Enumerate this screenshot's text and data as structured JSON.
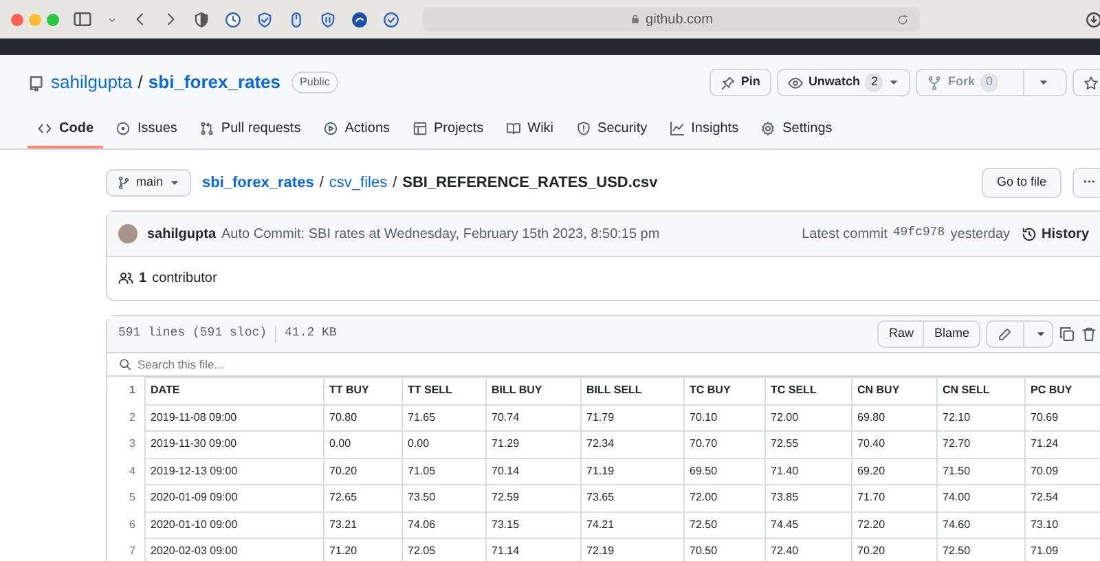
{
  "browser": {
    "address": "github.com"
  },
  "repo": {
    "owner": "sahilgupta",
    "separator": "/",
    "name": "sbi_forex_rates",
    "visibility": "Public",
    "actions": [
      {
        "label": "Pin",
        "kind": "pin",
        "disabled": false
      },
      {
        "label": "Unwatch",
        "kind": "watch",
        "count": "2",
        "disabled": false
      },
      {
        "label": "Fork",
        "kind": "fork",
        "count": "0",
        "disabled": true
      }
    ]
  },
  "tabs": [
    {
      "label": "Code",
      "kind": "code",
      "selected": true
    },
    {
      "label": "Issues",
      "kind": "issues",
      "selected": false
    },
    {
      "label": "Pull requests",
      "kind": "pulls",
      "selected": false
    },
    {
      "label": "Actions",
      "kind": "actions",
      "selected": false
    },
    {
      "label": "Projects",
      "kind": "projects",
      "selected": false
    },
    {
      "label": "Wiki",
      "kind": "wiki",
      "selected": false
    },
    {
      "label": "Security",
      "kind": "security",
      "selected": false
    },
    {
      "label": "Insights",
      "kind": "insights",
      "selected": false
    },
    {
      "label": "Settings",
      "kind": "settings",
      "selected": false
    }
  ],
  "breadcrumb": {
    "branch": "main",
    "path": [
      "sbi_forex_rates",
      "csv_files"
    ],
    "separator": "/",
    "file": "SBI_REFERENCE_RATES_USD.csv",
    "go_to_file": "Go to file",
    "more": "···"
  },
  "commit": {
    "author": "sahilgupta",
    "message": "Auto Commit: SBI rates at Wednesday, February 15th 2023, 8:50:15 pm",
    "latest_label": "Latest commit",
    "hash": "49fc978",
    "time": "yesterday",
    "history": "History"
  },
  "contributors": {
    "count": "1",
    "label": "contributor"
  },
  "file": {
    "lines": "591 lines (591 sloc)",
    "size": "41.2 KB",
    "buttons": [
      "Raw",
      "Blame"
    ]
  },
  "search": {
    "placeholder": "Search this file..."
  },
  "table": {
    "header_line": "1",
    "columns": [
      "DATE",
      "TT BUY",
      "TT SELL",
      "BILL BUY",
      "BILL SELL",
      "TC BUY",
      "TC SELL",
      "CN BUY",
      "CN SELL",
      "PC BUY"
    ],
    "rows": [
      {
        "line": "2",
        "cells": [
          "2019-11-08 09:00",
          "70.80",
          "71.65",
          "70.74",
          "71.79",
          "70.10",
          "72.00",
          "69.80",
          "72.10",
          "70.69"
        ]
      },
      {
        "line": "3",
        "cells": [
          "2019-11-30 09:00",
          "0.00",
          "0.00",
          "71.29",
          "72.34",
          "70.70",
          "72.55",
          "70.40",
          "72.70",
          "71.24"
        ]
      },
      {
        "line": "4",
        "cells": [
          "2019-12-13 09:00",
          "70.20",
          "71.05",
          "70.14",
          "71.19",
          "69.50",
          "71.40",
          "69.20",
          "71.50",
          "70.09"
        ]
      },
      {
        "line": "5",
        "cells": [
          "2020-01-09 09:00",
          "72.65",
          "73.50",
          "72.59",
          "73.65",
          "72.00",
          "73.85",
          "71.70",
          "74.00",
          "72.54"
        ]
      },
      {
        "line": "6",
        "cells": [
          "2020-01-10 09:00",
          "73.21",
          "74.06",
          "73.15",
          "74.21",
          "72.50",
          "74.45",
          "72.20",
          "74.60",
          "73.10"
        ]
      },
      {
        "line": "7",
        "cells": [
          "2020-02-03 09:00",
          "71.20",
          "72.05",
          "71.14",
          "72.19",
          "70.50",
          "72.40",
          "70.20",
          "72.50",
          "71.09"
        ]
      }
    ]
  }
}
